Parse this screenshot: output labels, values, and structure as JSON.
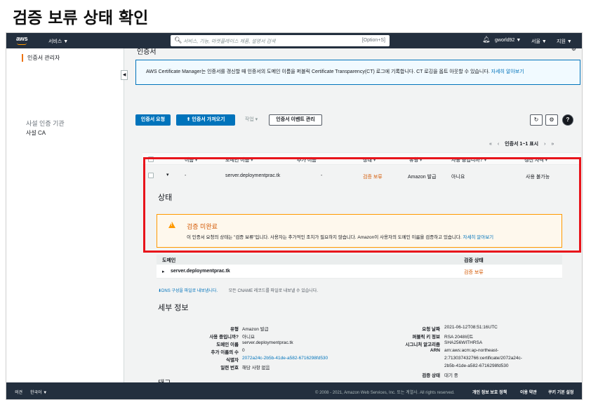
{
  "page_heading": "검증 보류 상태 확인",
  "topnav": {
    "logo": "aws",
    "services": "서비스 ▼",
    "search_placeholder": "서비스, 기능, 마켓플레이스 제품, 설명서 검색",
    "search_shortcut": "[Option+S]",
    "user": "gworld92 ▼",
    "region": "서울 ▼",
    "support": "지원 ▼"
  },
  "sidebar": {
    "active_item": "인증서 관리자",
    "section_title": "사설 인증 기관",
    "sub_item": "사설 CA"
  },
  "main": {
    "cropped_title": "인증서",
    "info_text": "AWS Certificate Manager는 인증서를 갱신할 때 인증서의 도메인 이름을 퍼블릭 Certificate Transparency(CT) 로그에 기록합니다. CT 로깅을 옵트 아웃할 수 있습니다.",
    "info_link": "자세히 알아보기",
    "buttons": {
      "request": "인증서 요청",
      "import": "인증서 가져오기",
      "actions": "작업 ▾",
      "events": "인증서 이벤트 관리"
    },
    "pager": {
      "first": "«",
      "prev": "‹",
      "label": "인증서 1~1 표시",
      "next": "›",
      "last": "»"
    },
    "table": {
      "headers": [
        "이름 ▾",
        "도메인 이름 ▾",
        "추가 이름",
        "상태 ▾",
        "유형 ▾",
        "사용 중입니까? ▾",
        "갱신 자격 ▾"
      ],
      "row": {
        "name": "-",
        "domain": "server.deploymentprac.tk",
        "additional": "-",
        "status": "검증 보류",
        "type": "Amazon 발급",
        "in_use": "아니요",
        "renewal": "사용 불가능"
      }
    },
    "status_section": {
      "title": "상태",
      "warning_title": "검증 미완료",
      "warning_text": "이 인증서 요청의 상태는 \"검증 보류\"입니다. 사용자는 추가적인 조치가 필요하지 않습니다. Amazon이 사용자의 도메인 이름을 검증하고 있습니다.",
      "warning_link": "자세히 알아보기"
    },
    "domain_table": {
      "col_domain": "도메인",
      "col_status": "검증 상태",
      "domain": "server.deploymentprac.tk",
      "status": "검증 보류"
    },
    "export": {
      "link": "DNS 구성을 파일로 내보냅니다.",
      "text": "모든 CNAME 레코드를 파일로 내보낼 수 있습니다."
    },
    "details": {
      "title": "세부 정보",
      "left": [
        {
          "k": "유형",
          "v": "Amazon 발급"
        },
        {
          "k": "사용 중입니까?",
          "v": "아니요"
        },
        {
          "k": "도메인 이름",
          "v": "server.deploymentprac.tk"
        },
        {
          "k": "추가 이름의 수",
          "v": "0"
        },
        {
          "k": "식별자",
          "v": "2072a24c-2b5b-41de-a582-6716298fd530"
        },
        {
          "k": "일련 번호",
          "v": "해당 사항 없음"
        }
      ],
      "right": [
        {
          "k": "요청 날짜",
          "v": "2021-06-12T08:51:16UTC"
        },
        {
          "k": "퍼블릭 키 정보",
          "v": "RSA 2048비트"
        },
        {
          "k": "시그니처 알고리즘",
          "v": "SHA256WITHRSA"
        },
        {
          "k": "ARN",
          "v": "arn:aws:acm:ap-northeast-"
        },
        {
          "k": "",
          "v": "2:713037432766:certificate/2072a24c-"
        },
        {
          "k": "",
          "v": "2b5b-41de-a582-6716298fd530"
        },
        {
          "k": "검증 상태",
          "v": "대기 중"
        }
      ]
    },
    "tags_title": "태그"
  },
  "footer": {
    "feedback": "의견",
    "language": "한국어 ▼",
    "copyright": "© 2008 - 2021, Amazon Web Services, Inc. 또는 계열사. All rights reserved.",
    "privacy": "개인 정보 보호 정책",
    "terms": "이용 약관",
    "cookies": "쿠키 기본 설정"
  },
  "colors": {
    "nav_bg": "#232f3e",
    "primary": "#0073bb",
    "warning": "#ff9900",
    "pending_text": "#d45b07",
    "highlight_border": "#e8141b"
  }
}
